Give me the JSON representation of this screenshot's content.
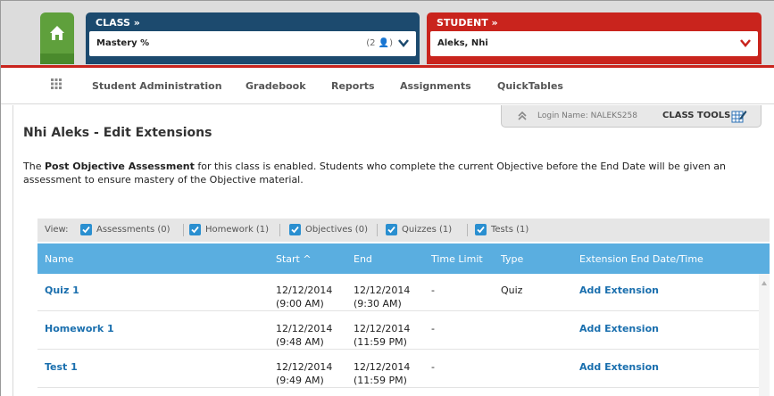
{
  "header": {
    "class_panel": {
      "title": "CLASS »",
      "value": "Mastery %",
      "count": "(2 👤)",
      "color": "#1c4a6e"
    },
    "student_panel": {
      "title": "STUDENT »",
      "value": "Aleks, Nhi",
      "color": "#c9241d"
    },
    "home_color": "#5fa03c"
  },
  "nav": {
    "items": [
      {
        "label": "Student Administration"
      },
      {
        "label": "Gradebook"
      },
      {
        "label": "Reports"
      },
      {
        "label": "Assignments"
      },
      {
        "label": "QuickTables"
      }
    ]
  },
  "tools": {
    "login": "Login Name: NALEKS258",
    "class_tools": "CLASS TOOLS"
  },
  "page": {
    "title": "Nhi Aleks - Edit Extensions",
    "notice_pre": "The ",
    "notice_bold": "Post Objective Assessment",
    "notice_post": " for this class is enabled. Students who complete the current Objective before the End Date will be given an assessment to ensure mastery of the Objective material."
  },
  "filter": {
    "view_label": "View:",
    "options": [
      {
        "label": "Assessments (0)",
        "checked": true
      },
      {
        "label": "Homework (1)",
        "checked": true
      },
      {
        "label": "Objectives (0)",
        "checked": true
      },
      {
        "label": "Quizzes (1)",
        "checked": true
      },
      {
        "label": "Tests (1)",
        "checked": true
      }
    ]
  },
  "table": {
    "headers": {
      "name": "Name",
      "start": "Start ^",
      "end": "End",
      "time_limit": "Time Limit",
      "type": "Type",
      "ext": "Extension End Date/Time"
    },
    "rows": [
      {
        "name": "Quiz 1",
        "start_date": "12/12/2014",
        "start_time": "(9:00 AM)",
        "end_date": "12/12/2014",
        "end_time": "(9:30 AM)",
        "time_limit": "-",
        "type": "Quiz",
        "ext": "Add Extension"
      },
      {
        "name": "Homework 1",
        "start_date": "12/12/2014",
        "start_time": "(9:48 AM)",
        "end_date": "12/12/2014",
        "end_time": "(11:59 PM)",
        "time_limit": "-",
        "type": "",
        "ext": "Add Extension"
      },
      {
        "name": "Test 1",
        "start_date": "12/12/2014",
        "start_time": "(9:49 AM)",
        "end_date": "12/12/2014",
        "end_time": "(11:59 PM)",
        "time_limit": "-",
        "type": "",
        "ext": "Add Extension"
      }
    ]
  },
  "colors": {
    "accent_blue": "#5aaee0",
    "link_blue": "#1a6fae"
  }
}
